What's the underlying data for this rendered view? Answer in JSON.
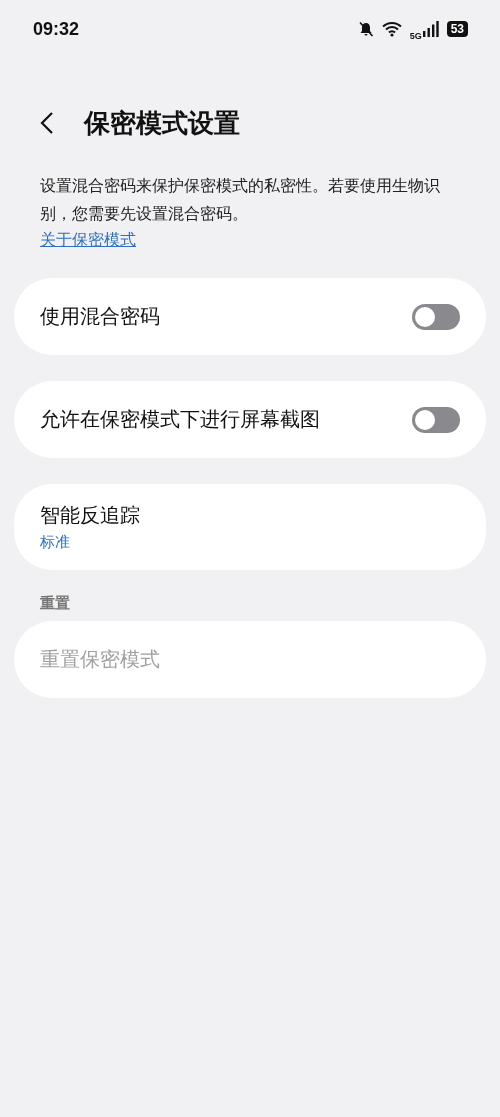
{
  "status_bar": {
    "time": "09:32",
    "network": "5G",
    "battery": "53"
  },
  "header": {
    "title": "保密模式设置"
  },
  "description": "设置混合密码来保护保密模式的私密性。若要使用生物识别，您需要先设置混合密码。",
  "link": "关于保密模式",
  "sections": [
    {
      "items": [
        {
          "kind": "toggle",
          "label": "使用混合密码",
          "on": false
        }
      ]
    },
    {
      "items": [
        {
          "kind": "toggle",
          "label": "允许在保密模式下进行屏幕截图",
          "on": false
        }
      ]
    },
    {
      "items": [
        {
          "kind": "value",
          "label": "智能反追踪",
          "value": "标准"
        }
      ]
    },
    {
      "title": "重置",
      "items": [
        {
          "kind": "action",
          "label": "重置保密模式",
          "disabled": true
        }
      ]
    }
  ]
}
